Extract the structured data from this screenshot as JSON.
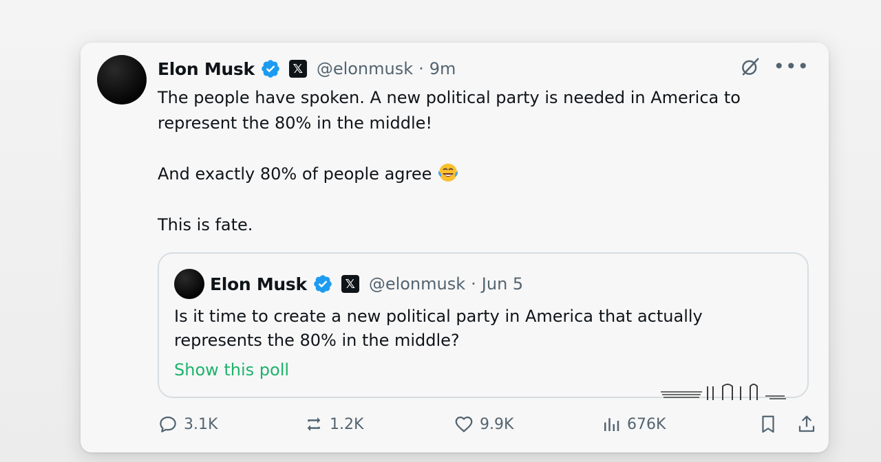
{
  "tweet": {
    "author_name": "Elon Musk",
    "handle": "@elonmusk",
    "separator": "·",
    "time": "9m",
    "paragraphs": [
      "The people have spoken. A new political party is needed in America to represent the 80% in the middle!",
      "And exactly 80% of people agree",
      "This is fate."
    ],
    "emoji": "face-with-tears-of-joy"
  },
  "quoted_tweet": {
    "author_name": "Elon Musk",
    "handle": "@elonmusk",
    "separator": "·",
    "date": "Jun 5",
    "text": "Is it time to create a new political party in America that actually represents the 80% in the middle?",
    "poll_link": "Show this poll"
  },
  "actions": {
    "replies": "3.1K",
    "reposts": "1.2K",
    "likes": "9.9K",
    "views": "676K"
  },
  "badges": {
    "x_logo": "𝕏"
  },
  "icons": {
    "verified": "verified-badge-icon",
    "grok": "grok-icon",
    "more": "more-icon",
    "reply": "reply-icon",
    "repost": "repost-icon",
    "like": "heart-icon",
    "views": "views-icon",
    "bookmark": "bookmark-icon",
    "share": "share-icon"
  },
  "colors": {
    "verified_blue": "#1d9bf0",
    "link_green": "#1db36b",
    "muted_text": "#536471"
  }
}
